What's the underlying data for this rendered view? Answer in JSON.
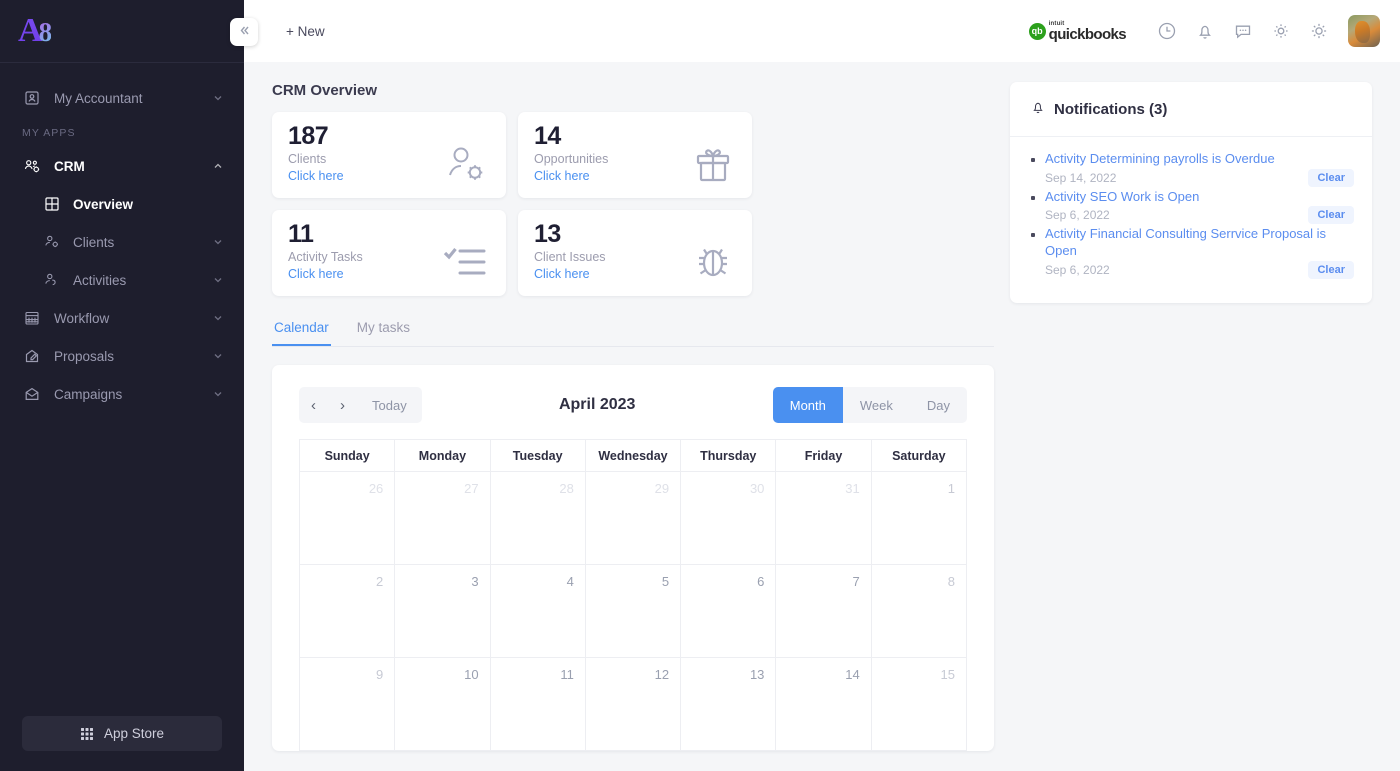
{
  "sidebar": {
    "logo": {
      "letter": "A",
      "mark": "8"
    },
    "top_item": {
      "label": "My Accountant",
      "icon": "contact-card-icon"
    },
    "section_label": "MY APPS",
    "items": [
      {
        "label": "CRM",
        "icon": "people-gear-icon",
        "expanded": true
      },
      {
        "label": "Overview",
        "icon": "grid-icon",
        "sub": true,
        "current": true
      },
      {
        "label": "Clients",
        "icon": "person-gear-icon",
        "sub": true
      },
      {
        "label": "Activities",
        "icon": "person-check-icon",
        "sub": true
      },
      {
        "label": "Workflow",
        "icon": "calendar-grid-icon"
      },
      {
        "label": "Proposals",
        "icon": "document-pen-icon"
      },
      {
        "label": "Campaigns",
        "icon": "envelope-open-icon"
      }
    ],
    "app_store": {
      "label": "App Store",
      "icon": "apps-grid-icon"
    },
    "collapse": {
      "icon": "chevron-double-left-icon"
    }
  },
  "topbar": {
    "new_label": "+ New",
    "quickbooks": {
      "badge": "qb",
      "intuit": "intuit",
      "name": "quickbooks"
    },
    "icons": [
      "clock-icon",
      "bell-icon",
      "chat-icon",
      "gear-icon",
      "sun-icon"
    ],
    "avatar": "user-avatar"
  },
  "main": {
    "page_title": "CRM Overview",
    "stats": [
      {
        "value": "187",
        "label": "Clients",
        "link": "Click here",
        "icon": "person-gear-icon"
      },
      {
        "value": "14",
        "label": "Opportunities",
        "link": "Click here",
        "icon": "gift-icon"
      },
      {
        "value": "11",
        "label": "Activity Tasks",
        "link": "Click here",
        "icon": "checklist-icon"
      },
      {
        "value": "13",
        "label": "Client Issues",
        "link": "Click here",
        "icon": "bug-icon"
      }
    ],
    "tabs": [
      {
        "label": "Calendar",
        "active": true
      },
      {
        "label": "My tasks",
        "active": false
      }
    ],
    "calendar": {
      "prev": "‹",
      "next": "›",
      "today_label": "Today",
      "title": "April 2023",
      "views": [
        {
          "label": "Month",
          "active": true
        },
        {
          "label": "Week",
          "active": false
        },
        {
          "label": "Day",
          "active": false
        }
      ],
      "day_headers": [
        "Sunday",
        "Monday",
        "Tuesday",
        "Wednesday",
        "Thursday",
        "Friday",
        "Saturday"
      ],
      "weeks": [
        [
          {
            "d": "26",
            "muted": true
          },
          {
            "d": "27",
            "muted": true
          },
          {
            "d": "28",
            "muted": true
          },
          {
            "d": "29",
            "muted": true
          },
          {
            "d": "30",
            "muted": true
          },
          {
            "d": "31",
            "muted": true
          },
          {
            "d": "1",
            "muted": false,
            "weekend": true
          }
        ],
        [
          {
            "d": "2",
            "muted": false,
            "weekend": true
          },
          {
            "d": "3",
            "muted": false
          },
          {
            "d": "4",
            "muted": false
          },
          {
            "d": "5",
            "muted": false
          },
          {
            "d": "6",
            "muted": false
          },
          {
            "d": "7",
            "muted": false
          },
          {
            "d": "8",
            "muted": false,
            "weekend": true
          }
        ],
        [
          {
            "d": "9",
            "muted": false,
            "weekend": true
          },
          {
            "d": "10",
            "muted": false
          },
          {
            "d": "11",
            "muted": false
          },
          {
            "d": "12",
            "muted": false
          },
          {
            "d": "13",
            "muted": false
          },
          {
            "d": "14",
            "muted": false
          },
          {
            "d": "15",
            "muted": false,
            "weekend": true
          }
        ]
      ]
    }
  },
  "notifications": {
    "title": "Notifications (3)",
    "bell_icon": "bell-icon",
    "clear_label": "Clear",
    "items": [
      {
        "text": "Activity Determining payrolls is Overdue",
        "date": "Sep 14, 2022",
        "clear": "Clear"
      },
      {
        "text": "Activity SEO Work is Open",
        "date": "Sep 6, 2022",
        "clear": "Clear"
      },
      {
        "text": "Activity Financial Consulting Serrvice Proposal is Open",
        "date": "Sep 6, 2022",
        "clear": "Clear"
      }
    ]
  },
  "colors": {
    "sidebar_bg": "#1e1e2d",
    "accent_blue": "#4a90f0",
    "link_blue": "#5b8def",
    "page_bg": "#f5f6f8",
    "card_bg": "#ffffff",
    "quickbooks_green": "#2ca01c",
    "muted_text": "#9c9cae"
  }
}
